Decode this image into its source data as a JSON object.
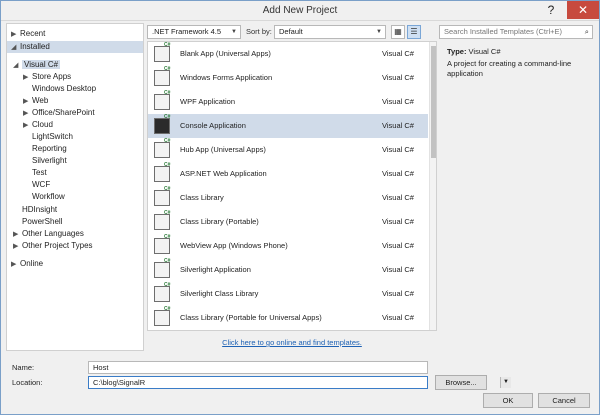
{
  "window": {
    "title": "Add New Project",
    "help": "?",
    "close": "✕"
  },
  "tree": {
    "items": [
      {
        "arrow": "▶",
        "label": "Recent",
        "indent": 0
      },
      {
        "arrow": "◢",
        "label": "Installed",
        "indent": 0
      },
      {
        "arrow": "◢",
        "label": "Visual C#",
        "indent": 1
      },
      {
        "arrow": "▶",
        "label": "Store Apps",
        "indent": 2
      },
      {
        "arrow": "",
        "label": "Windows Desktop",
        "indent": 2
      },
      {
        "arrow": "▶",
        "label": "Web",
        "indent": 2
      },
      {
        "arrow": "▶",
        "label": "Office/SharePoint",
        "indent": 2
      },
      {
        "arrow": "▶",
        "label": "Cloud",
        "indent": 2
      },
      {
        "arrow": "",
        "label": "LightSwitch",
        "indent": 2
      },
      {
        "arrow": "",
        "label": "Reporting",
        "indent": 2
      },
      {
        "arrow": "",
        "label": "Silverlight",
        "indent": 2
      },
      {
        "arrow": "",
        "label": "Test",
        "indent": 2
      },
      {
        "arrow": "",
        "label": "WCF",
        "indent": 2
      },
      {
        "arrow": "",
        "label": "Workflow",
        "indent": 2
      },
      {
        "arrow": "",
        "label": "HDInsight",
        "indent": 1
      },
      {
        "arrow": "",
        "label": "PowerShell",
        "indent": 1
      },
      {
        "arrow": "▶",
        "label": "Other Languages",
        "indent": 1
      },
      {
        "arrow": "▶",
        "label": "Other Project Types",
        "indent": 1
      },
      {
        "arrow": "▶",
        "label": "Online",
        "indent": 0
      }
    ]
  },
  "toolbar": {
    "framework": ".NET Framework 4.5",
    "sort_label": "Sort by:",
    "sort_value": "Default",
    "search_placeholder": "Search Installed Templates (Ctrl+E)"
  },
  "templates": [
    {
      "name": "Blank App (Universal Apps)",
      "lang": "Visual C#"
    },
    {
      "name": "Windows Forms Application",
      "lang": "Visual C#"
    },
    {
      "name": "WPF Application",
      "lang": "Visual C#"
    },
    {
      "name": "Console Application",
      "lang": "Visual C#"
    },
    {
      "name": "Hub App (Universal Apps)",
      "lang": "Visual C#"
    },
    {
      "name": "ASP.NET Web Application",
      "lang": "Visual C#"
    },
    {
      "name": "Class Library",
      "lang": "Visual C#"
    },
    {
      "name": "Class Library (Portable)",
      "lang": "Visual C#"
    },
    {
      "name": "WebView App (Windows Phone)",
      "lang": "Visual C#"
    },
    {
      "name": "Silverlight Application",
      "lang": "Visual C#"
    },
    {
      "name": "Silverlight Class Library",
      "lang": "Visual C#"
    },
    {
      "name": "Class Library (Portable for Universal Apps)",
      "lang": "Visual C#"
    }
  ],
  "details": {
    "type_label": "Type:",
    "type_value": "Visual C#",
    "description": "A project for creating a command-line application"
  },
  "online_link": "Click here to go online and find templates.",
  "form": {
    "name_label": "Name:",
    "name_value": "Host",
    "location_label": "Location:",
    "location_value": "C:\\blog\\SignalR",
    "browse": "Browse...",
    "ok": "OK",
    "cancel": "Cancel"
  }
}
